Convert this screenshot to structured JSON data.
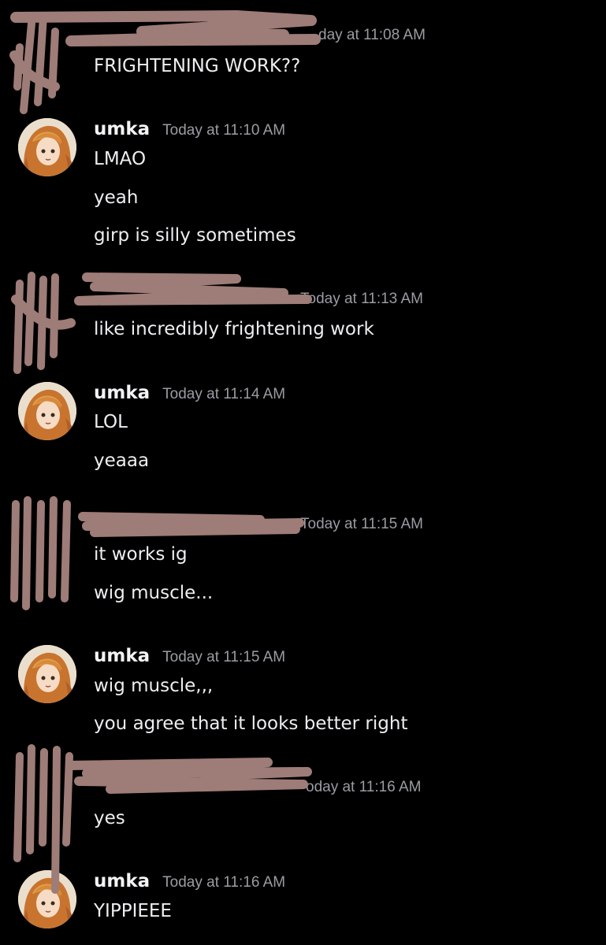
{
  "colors": {
    "background": "#000000",
    "text": "#eceef0",
    "timestamp": "#9a9ca3",
    "redaction": "#9e7c77"
  },
  "messages": [
    {
      "author": "",
      "author_redacted": true,
      "timestamp": "day at 11:08 AM",
      "lines": [
        "FRIGHTENING WORK??"
      ]
    },
    {
      "author": "umka",
      "avatar_icon": "anime-girl-avatar",
      "timestamp": "Today at 11:10 AM",
      "lines": [
        "LMAO",
        "yeah",
        "girp is silly sometimes"
      ]
    },
    {
      "author": "",
      "author_redacted": true,
      "timestamp": "Today at 11:13 AM",
      "lines": [
        "like incredibly frightening work"
      ]
    },
    {
      "author": "umka",
      "avatar_icon": "anime-girl-avatar",
      "timestamp": "Today at 11:14 AM",
      "lines": [
        "LOL",
        "yeaaa"
      ]
    },
    {
      "author": "",
      "author_redacted": true,
      "timestamp": "Today at 11:15 AM",
      "lines": [
        "it works ig",
        "wig muscle..."
      ]
    },
    {
      "author": "umka",
      "avatar_icon": "anime-girl-avatar",
      "timestamp": "Today at 11:15 AM",
      "lines": [
        "wig muscle,,,",
        "you agree that it looks better right"
      ]
    },
    {
      "author": "",
      "author_redacted": true,
      "timestamp": "oday at 11:16 AM",
      "lines": [
        "yes"
      ]
    },
    {
      "author": "umka",
      "avatar_icon": "anime-girl-avatar",
      "timestamp": "Today at 11:16 AM",
      "lines": [
        "YIPPIEEE"
      ]
    }
  ]
}
